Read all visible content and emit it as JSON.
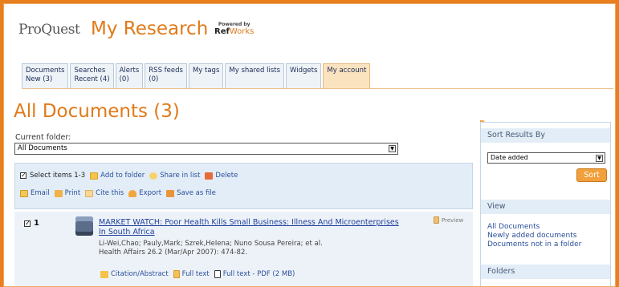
{
  "header": {
    "logo": "ProQuest",
    "title": "My Research",
    "powered_by": "Powered by",
    "refworks_ref": "Ref",
    "refworks_works": "Works"
  },
  "tabs": [
    {
      "line1": "Documents",
      "line2": "New (3)"
    },
    {
      "line1": "Searches",
      "line2": "Recent (4)"
    },
    {
      "line1": "Alerts",
      "line2": "(0)"
    },
    {
      "line1": "RSS feeds",
      "line2": "(0)"
    },
    {
      "line1": "My tags",
      "line2": ""
    },
    {
      "line1": "My shared lists",
      "line2": ""
    },
    {
      "line1": "Widgets",
      "line2": ""
    },
    {
      "line1": "My account",
      "line2": ""
    }
  ],
  "main": {
    "page_title": "All Documents (3)",
    "folder_label": "Current folder:",
    "folder_value": "All Documents"
  },
  "actions": {
    "select_items": "Select items 1-3",
    "add_to_folder": "Add to folder",
    "share_in_list": "Share in list",
    "delete": "Delete",
    "email": "Email",
    "print": "Print",
    "cite_this": "Cite this",
    "export": "Export",
    "save_as_file": "Save as file"
  },
  "results": [
    {
      "number": "1",
      "title": "MARKET WATCH: Poor Health Kills Small Business: Illness And Microenterprises In South Africa",
      "authors": "Li-Wei,Chao; Pauly,Mark; Szrek,Helena; Nuno Sousa Pereira; et al.",
      "source": "Health Affairs 26.2 (Mar/Apr 2007): 474-82.",
      "preview": "Preview",
      "citation_abstract": "Citation/Abstract",
      "full_text": "Full text",
      "full_text_pdf": "Full text - PDF (2 MB)"
    }
  ],
  "sidebar": {
    "sort_heading": "Sort Results By",
    "sort_value": "Date added",
    "sort_button": "Sort",
    "view_heading": "View",
    "view_links": [
      "All Documents",
      "Newly added documents",
      "Documents not in a folder"
    ],
    "folders_heading": "Folders"
  }
}
